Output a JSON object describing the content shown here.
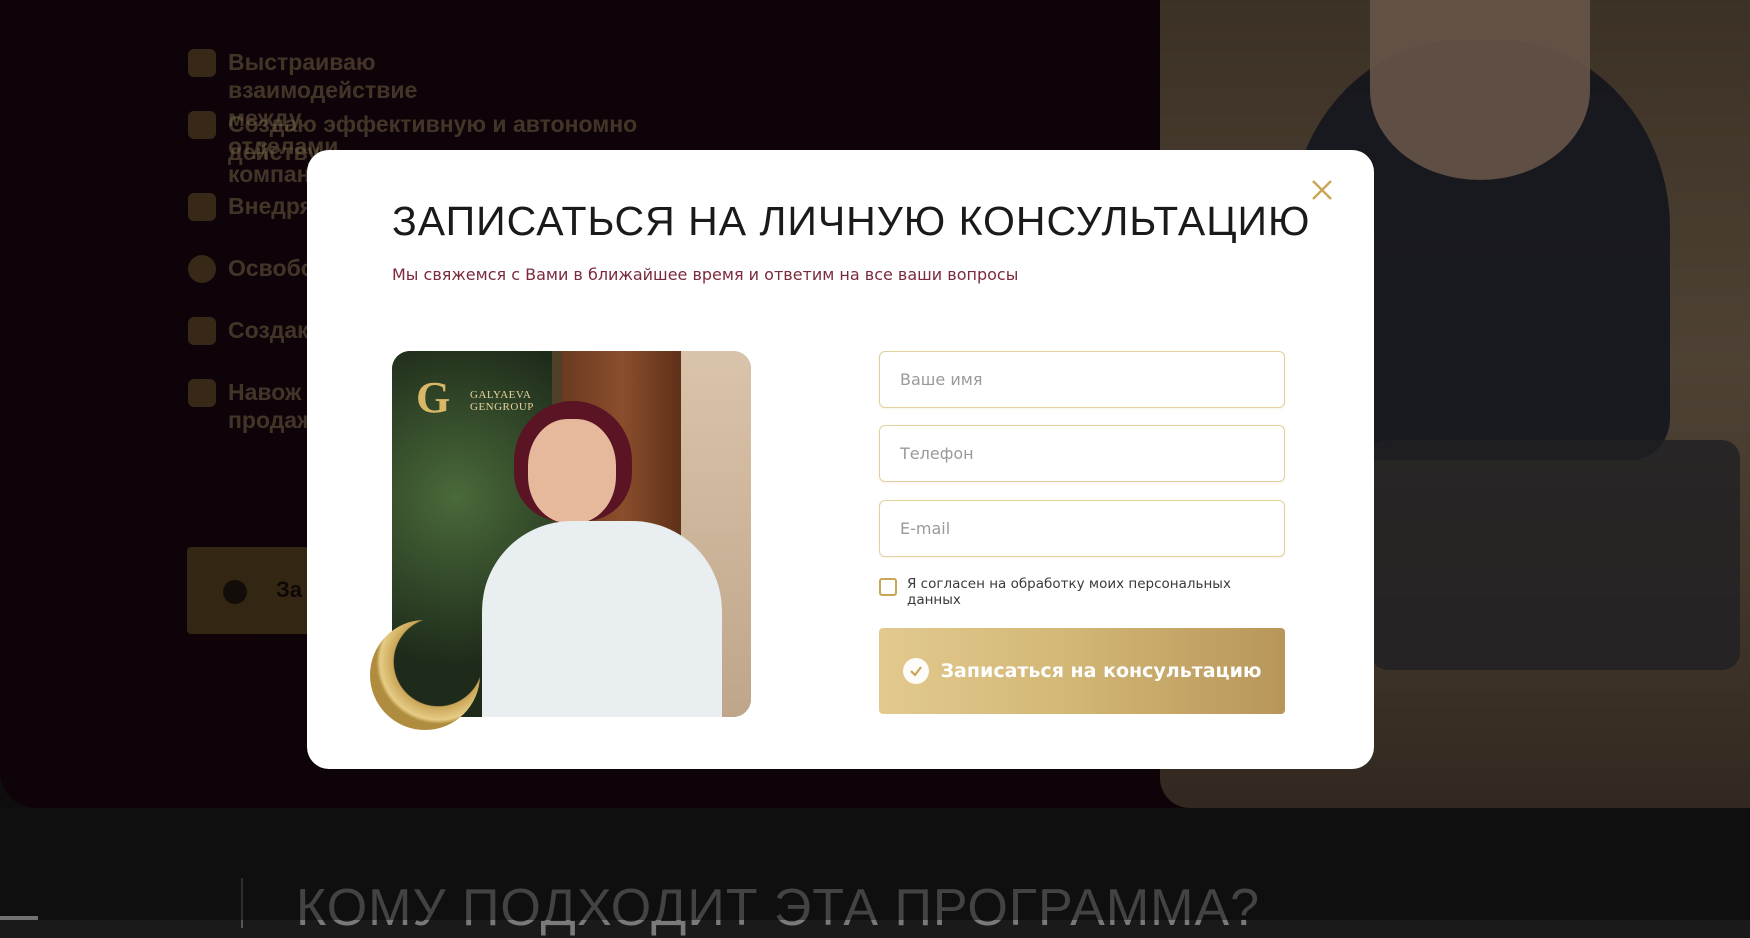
{
  "background": {
    "list": [
      {
        "icon": "team-icon",
        "text": "Выстраиваю взаимодействие между отделами компании."
      },
      {
        "icon": "people-icon",
        "text": "Создаю эффективную и автономно действу"
      },
      {
        "icon": "gear-icon",
        "text": "Внедря"
      },
      {
        "icon": "stopwatch-icon",
        "text": "Освобо"
      },
      {
        "icon": "building-icon",
        "text": "Создак"
      },
      {
        "icon": "document-icon",
        "text": "Навож"
      }
    ],
    "list_extra_line2": "продаж",
    "button_label": "За",
    "section_title": "КОМУ ПОДХОДИТ ЭТА ПРОГРАММА?"
  },
  "modal": {
    "title": "ЗАПИСАТЬСЯ НА ЛИЧНУЮ КОНСУЛЬТАЦИЮ",
    "subtitle": "Мы свяжемся с Вами в ближайшее время и ответим на все ваши вопросы",
    "logo": {
      "mark": "G",
      "line1": "GALYAEVA",
      "line2": "GENGROUP"
    },
    "fields": {
      "name_placeholder": "Ваше имя",
      "phone_placeholder": "Телефон",
      "email_placeholder": "E-mail"
    },
    "consent_text": "Я согласен на обработку моих персональных данных",
    "submit_label": "Записаться на консультацию"
  },
  "colors": {
    "accent_gold": "#c9a556",
    "subtitle": "#7b2a3b",
    "title": "#1a1a1a"
  }
}
